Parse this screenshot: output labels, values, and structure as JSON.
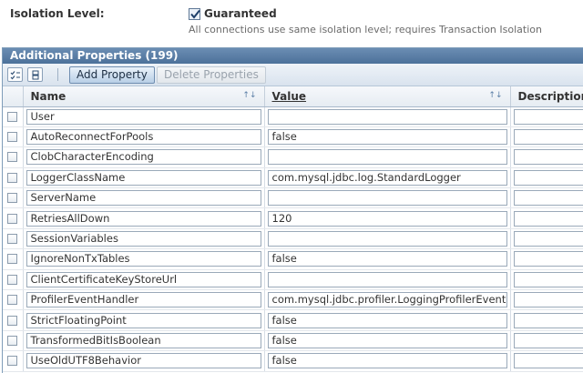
{
  "isolation": {
    "label": "Isolation Level:",
    "checked": true,
    "value_label": "Guaranteed",
    "help": "All connections use same isolation level; requires Transaction Isolation"
  },
  "panel": {
    "title": "Additional Properties (199)",
    "toolbar": {
      "select_all_icon": "select-all-icon",
      "deselect_all_icon": "deselect-all-icon",
      "add_label": "Add Property",
      "delete_label": "Delete Properties"
    },
    "columns": [
      "Name",
      "Value",
      "Description:"
    ],
    "rows": [
      {
        "name": "User",
        "value": ""
      },
      {
        "name": "AutoReconnectForPools",
        "value": "false"
      },
      {
        "name": "ClobCharacterEncoding",
        "value": ""
      },
      {
        "name": "LoggerClassName",
        "value": "com.mysql.jdbc.log.StandardLogger"
      },
      {
        "name": "ServerName",
        "value": ""
      },
      {
        "name": "RetriesAllDown",
        "value": "120"
      },
      {
        "name": "SessionVariables",
        "value": ""
      },
      {
        "name": "IgnoreNonTxTables",
        "value": "false"
      },
      {
        "name": "ClientCertificateKeyStoreUrl",
        "value": ""
      },
      {
        "name": "ProfilerEventHandler",
        "value": "com.mysql.jdbc.profiler.LoggingProfilerEventHa"
      },
      {
        "name": "StrictFloatingPoint",
        "value": "false"
      },
      {
        "name": "TransformedBitIsBoolean",
        "value": "false"
      },
      {
        "name": "UseOldUTF8Behavior",
        "value": "false"
      }
    ]
  },
  "colors": {
    "header_bar": "#4c719a",
    "accent": "#6f8db0"
  }
}
